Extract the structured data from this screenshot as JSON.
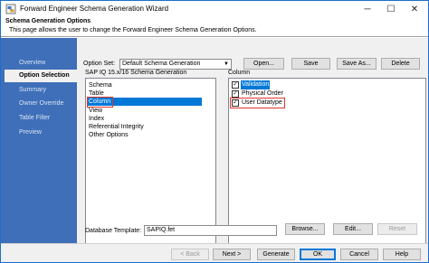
{
  "window": {
    "title": "Forward Engineer Schema Generation Wizard",
    "controls": {
      "minimize": "─",
      "maximize": "☐",
      "close": "✕"
    }
  },
  "header": {
    "title": "Schema Generation Options",
    "description": "This page allows the user to change the Forward Engineer Schema Generation Options."
  },
  "nav": {
    "items": [
      {
        "label": "Overview"
      },
      {
        "label": "Option Selection"
      },
      {
        "label": "Summary"
      },
      {
        "label": "Owner Override"
      },
      {
        "label": "Table Filter"
      },
      {
        "label": "Preview"
      }
    ],
    "active": "Option Selection"
  },
  "options": {
    "option_set_label": "Option Set:",
    "option_set_value": "Default Schema Generation",
    "open_label": "Open...",
    "save_label": "Save",
    "save_as_label": "Save As...",
    "delete_label": "Delete"
  },
  "left_panel": {
    "title": "SAP IQ 15.x/16 Schema Generation",
    "items": [
      "Schema",
      "Table",
      "Column",
      "View",
      "Index",
      "Referential Integrity",
      "Other Options"
    ],
    "selected": "Column"
  },
  "right_panel": {
    "title": "Column",
    "items": [
      {
        "label": "Validation",
        "checked": true,
        "selected": true
      },
      {
        "label": "Physical Order",
        "checked": true,
        "selected": false
      },
      {
        "label": "User Datatype",
        "checked": true,
        "selected": false
      }
    ]
  },
  "template": {
    "label": "Database Template:",
    "value": "SAPIQ.fet",
    "browse_label": "Browse...",
    "edit_label": "Edit...",
    "reset_label": "Reset"
  },
  "footer": {
    "back_label": "< Back",
    "next_label": "Next >",
    "generate_label": "Generate",
    "ok_label": "OK",
    "cancel_label": "Cancel",
    "help_label": "Help"
  },
  "colors": {
    "nav_background": "#3f6fb8",
    "selection": "#0078d7",
    "highlight_box": "#e0352b"
  }
}
